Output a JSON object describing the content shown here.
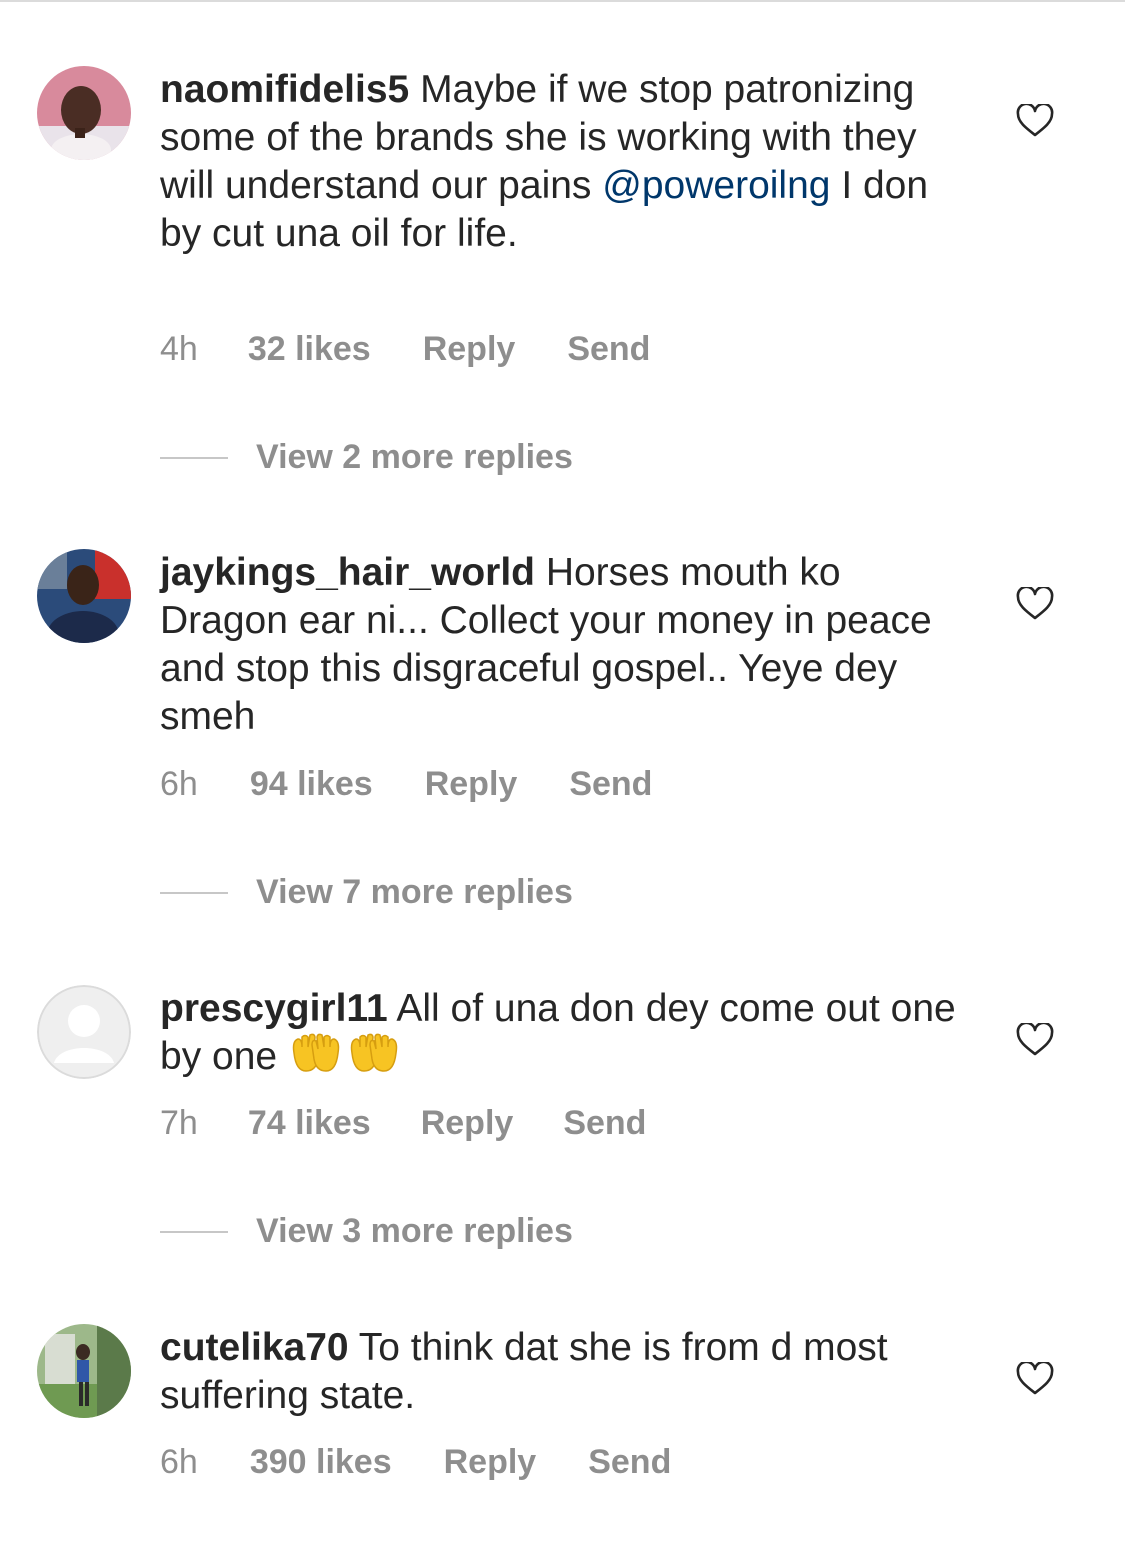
{
  "comments": [
    {
      "username": "naomifidelis5",
      "text_before": " Maybe if we stop patronizing some of the brands she is working with they will understand our pains ",
      "mention": "@poweroilng",
      "text_after": " I don by cut una oil for life.",
      "time": "4h",
      "likes": "32 likes",
      "reply": "Reply",
      "send": "Send",
      "view_more": "View 2 more replies",
      "avatar_icon": "profile-photo"
    },
    {
      "username": "jaykings_hair_world",
      "text_before": " Horses mouth ko Dragon ear ni... Collect your money in peace and stop this disgraceful gospel.. Yeye dey smeh",
      "time": "6h",
      "likes": "94 likes",
      "reply": "Reply",
      "send": "Send",
      "view_more": "View 7 more replies",
      "avatar_icon": "profile-photo"
    },
    {
      "username": "prescygirl11",
      "text_before": " All of una don dey come out one by one ",
      "emoji_icon": "raised-hands-emoji",
      "time": "7h",
      "likes": "74 likes",
      "reply": "Reply",
      "send": "Send",
      "view_more": "View 3 more replies",
      "avatar_icon": "default-avatar"
    },
    {
      "username": "cutelika70",
      "text_before": " To think dat she is from d most suffering state.",
      "time": "6h",
      "likes": "390 likes",
      "reply": "Reply",
      "send": "Send",
      "avatar_icon": "profile-photo"
    }
  ],
  "colors": {
    "text": "#262626",
    "meta": "#8e8e8e",
    "mention": "#00376b",
    "divider": "#c7c7c7"
  }
}
